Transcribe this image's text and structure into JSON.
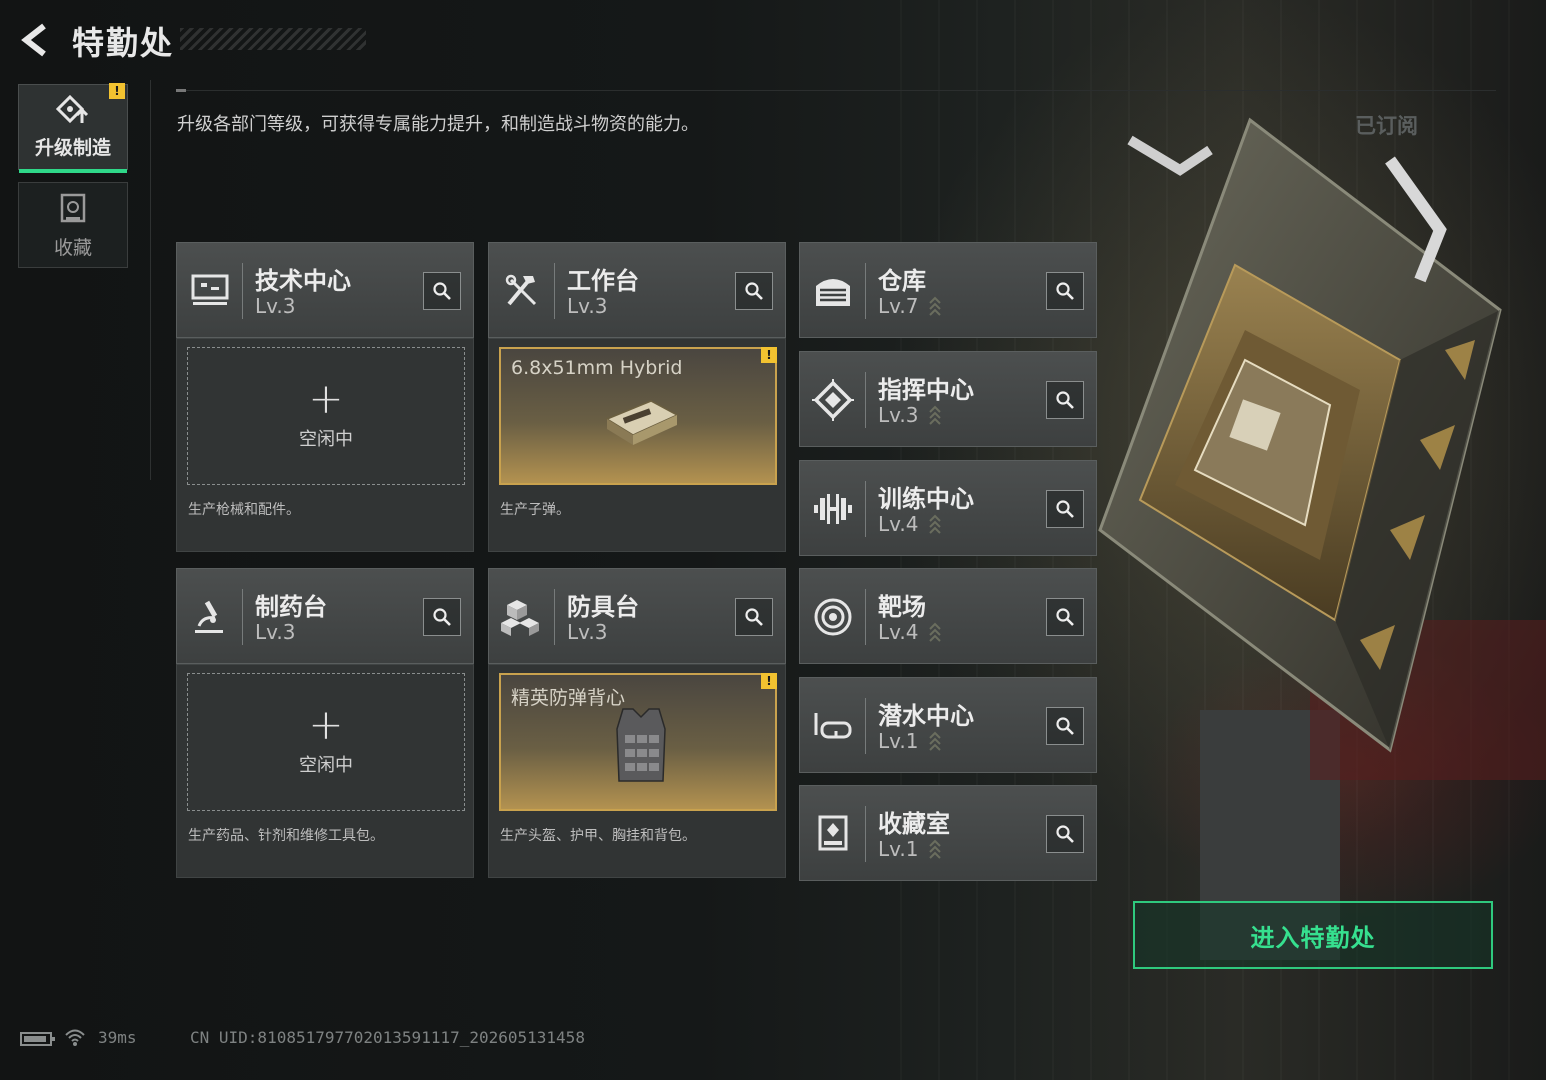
{
  "header": {
    "title": "特勤处"
  },
  "sidebar": {
    "items": [
      {
        "label": "升级制造",
        "active": true,
        "badge": "!"
      },
      {
        "label": "收藏",
        "active": false
      }
    ]
  },
  "description": "升级各部门等级，可获得专属能力提升，和制造战斗物资的能力。",
  "subscribed_label": "已订阅",
  "departments": {
    "tech": {
      "name": "技术中心",
      "level": "Lv.3",
      "icon": "monitor-icon"
    },
    "workbench": {
      "name": "工作台",
      "level": "Lv.3",
      "icon": "tools-icon"
    },
    "warehouse": {
      "name": "仓库",
      "level": "Lv.7",
      "icon": "warehouse-icon"
    },
    "command": {
      "name": "指挥中心",
      "level": "Lv.3",
      "icon": "chip-icon"
    },
    "training": {
      "name": "训练中心",
      "level": "Lv.4",
      "icon": "dumbbell-icon"
    },
    "pharmacy": {
      "name": "制药台",
      "level": "Lv.3",
      "icon": "microscope-icon"
    },
    "armor": {
      "name": "防具台",
      "level": "Lv.3",
      "icon": "boxes-icon"
    },
    "range": {
      "name": "靶场",
      "level": "Lv.4",
      "icon": "target-icon"
    },
    "diving": {
      "name": "潜水中心",
      "level": "Lv.1",
      "icon": "diving-mask-icon"
    },
    "collection": {
      "name": "收藏室",
      "level": "Lv.1",
      "icon": "collection-icon"
    }
  },
  "slots": {
    "tech": {
      "state": "idle",
      "plus": "+",
      "idle_label": "空闲中",
      "desc": "生产枪械和配件。"
    },
    "workbench": {
      "state": "producing",
      "item": "6.8x51mm Hybrid",
      "badge": "!",
      "desc": "生产子弹。"
    },
    "pharmacy": {
      "state": "idle",
      "plus": "+",
      "idle_label": "空闲中",
      "desc": "生产药品、针剂和维修工具包。"
    },
    "armor": {
      "state": "producing",
      "item": "精英防弹背心",
      "badge": "!",
      "desc": "生产头盔、护甲、胸挂和背包。"
    }
  },
  "enter_button": "进入特勤处",
  "status_bar": {
    "ping": "39ms",
    "uid": "CN UID:810851797702013591117_202605131458"
  },
  "colors": {
    "accent": "#2fd889",
    "warning": "#f2c230",
    "gold": "#c9a24e"
  }
}
